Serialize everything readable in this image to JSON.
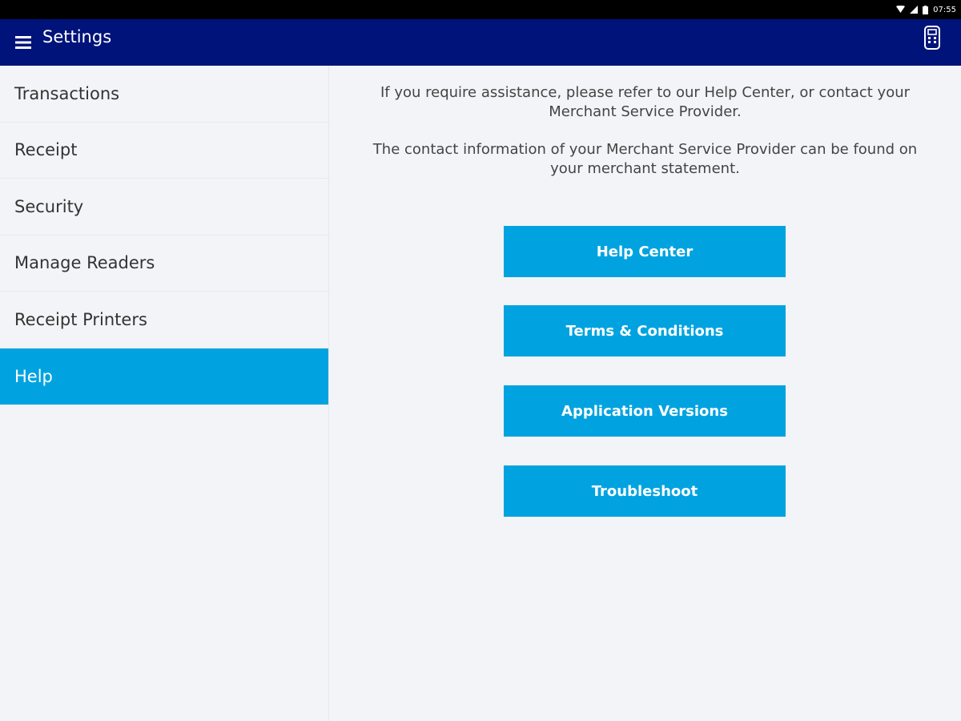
{
  "status_bar": {
    "time": "07:55",
    "icons": [
      "wifi-icon",
      "signal-icon",
      "battery-icon"
    ]
  },
  "app_bar": {
    "title": "Settings",
    "icons": [
      "menu-icon",
      "card-reader-icon"
    ]
  },
  "sidebar": {
    "items": [
      {
        "label": "Transactions",
        "active": false
      },
      {
        "label": "Receipt",
        "active": false
      },
      {
        "label": "Security",
        "active": false
      },
      {
        "label": "Manage Readers",
        "active": false
      },
      {
        "label": "Receipt Printers",
        "active": false
      },
      {
        "label": "Help",
        "active": true
      }
    ]
  },
  "main": {
    "paragraphs": [
      "If you require assistance, please refer to our Help Center, or contact your Merchant Service Provider.",
      "The contact information of your Merchant Service Provider can be found on your merchant statement."
    ],
    "buttons": [
      {
        "label": "Help Center"
      },
      {
        "label": "Terms & Conditions"
      },
      {
        "label": "Application Versions"
      },
      {
        "label": "Troubleshoot"
      }
    ]
  },
  "colors": {
    "app_bar": "#00137a",
    "accent": "#00a3e0",
    "background": "#f2f4f7"
  }
}
